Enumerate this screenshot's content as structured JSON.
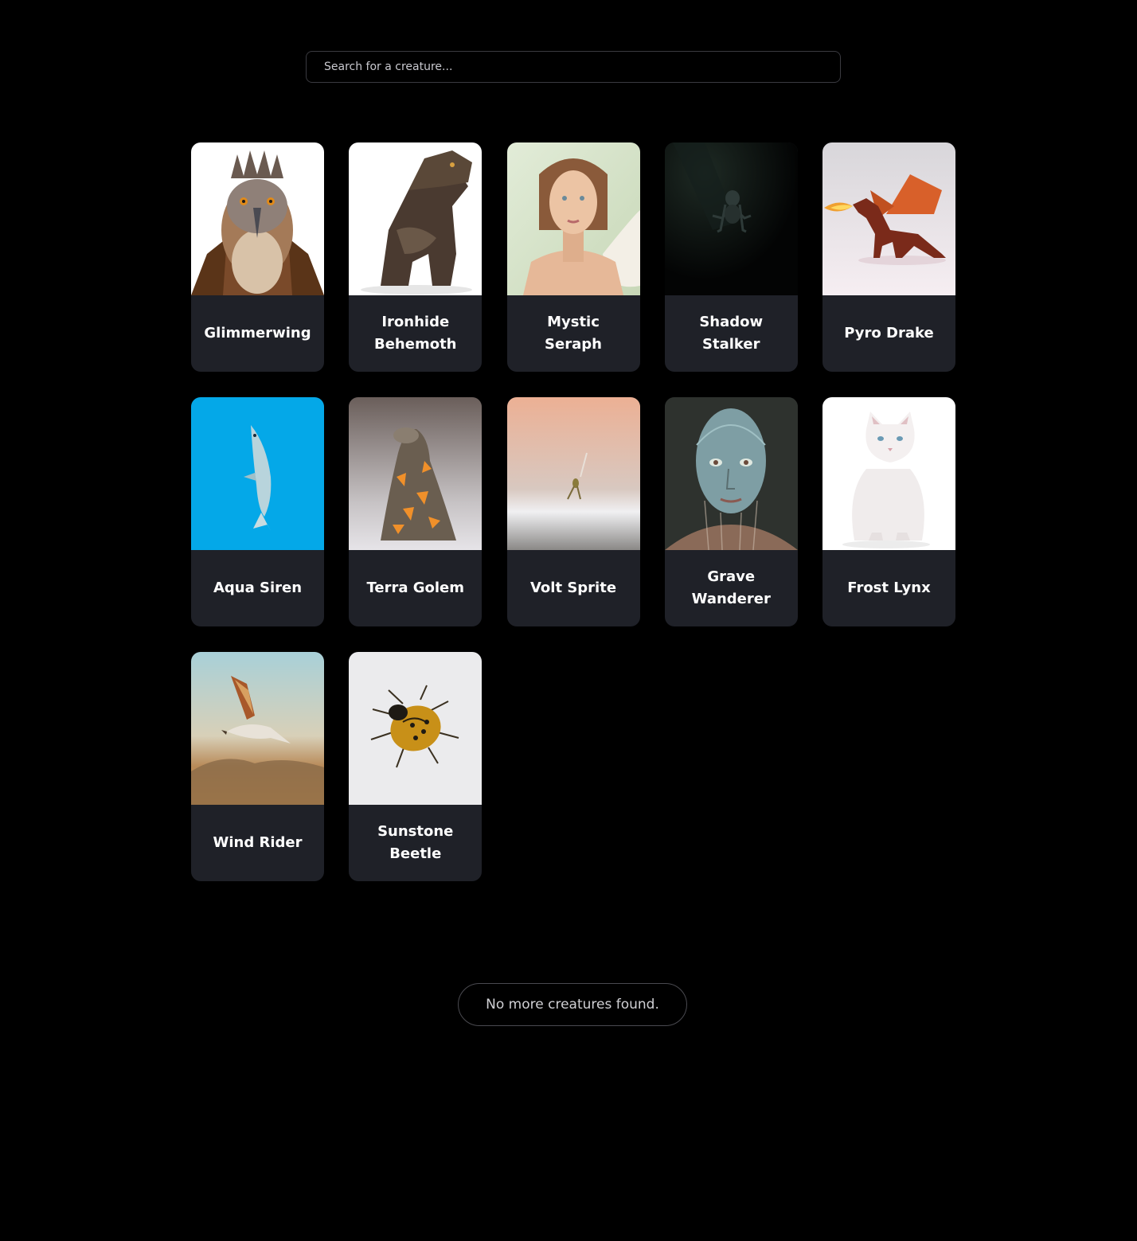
{
  "search": {
    "placeholder": "Search for a creature...",
    "value": ""
  },
  "creatures": [
    {
      "name": "Glimmerwing",
      "icon": "hawk-portrait-image"
    },
    {
      "name": "Ironhide Behemoth",
      "icon": "armored-reptile-image"
    },
    {
      "name": "Mystic Seraph",
      "icon": "winged-woman-image"
    },
    {
      "name": "Shadow Stalker",
      "icon": "shadow-creature-image"
    },
    {
      "name": "Pyro Drake",
      "icon": "fire-dragon-image"
    },
    {
      "name": "Aqua Siren",
      "icon": "fish-image"
    },
    {
      "name": "Terra Golem",
      "icon": "lava-rock-golem-image"
    },
    {
      "name": "Volt Sprite",
      "icon": "tiny-sprite-image"
    },
    {
      "name": "Grave Wanderer",
      "icon": "translucent-face-image"
    },
    {
      "name": "Frost Lynx",
      "icon": "white-cat-image"
    },
    {
      "name": "Wind Rider",
      "icon": "flying-bird-image"
    },
    {
      "name": "Sunstone Beetle",
      "icon": "golden-beetle-image"
    }
  ],
  "footer": {
    "end_message": "No more creatures found."
  },
  "colors": {
    "background": "#000000",
    "card_background": "#1f2128",
    "text": "#ffffff"
  }
}
